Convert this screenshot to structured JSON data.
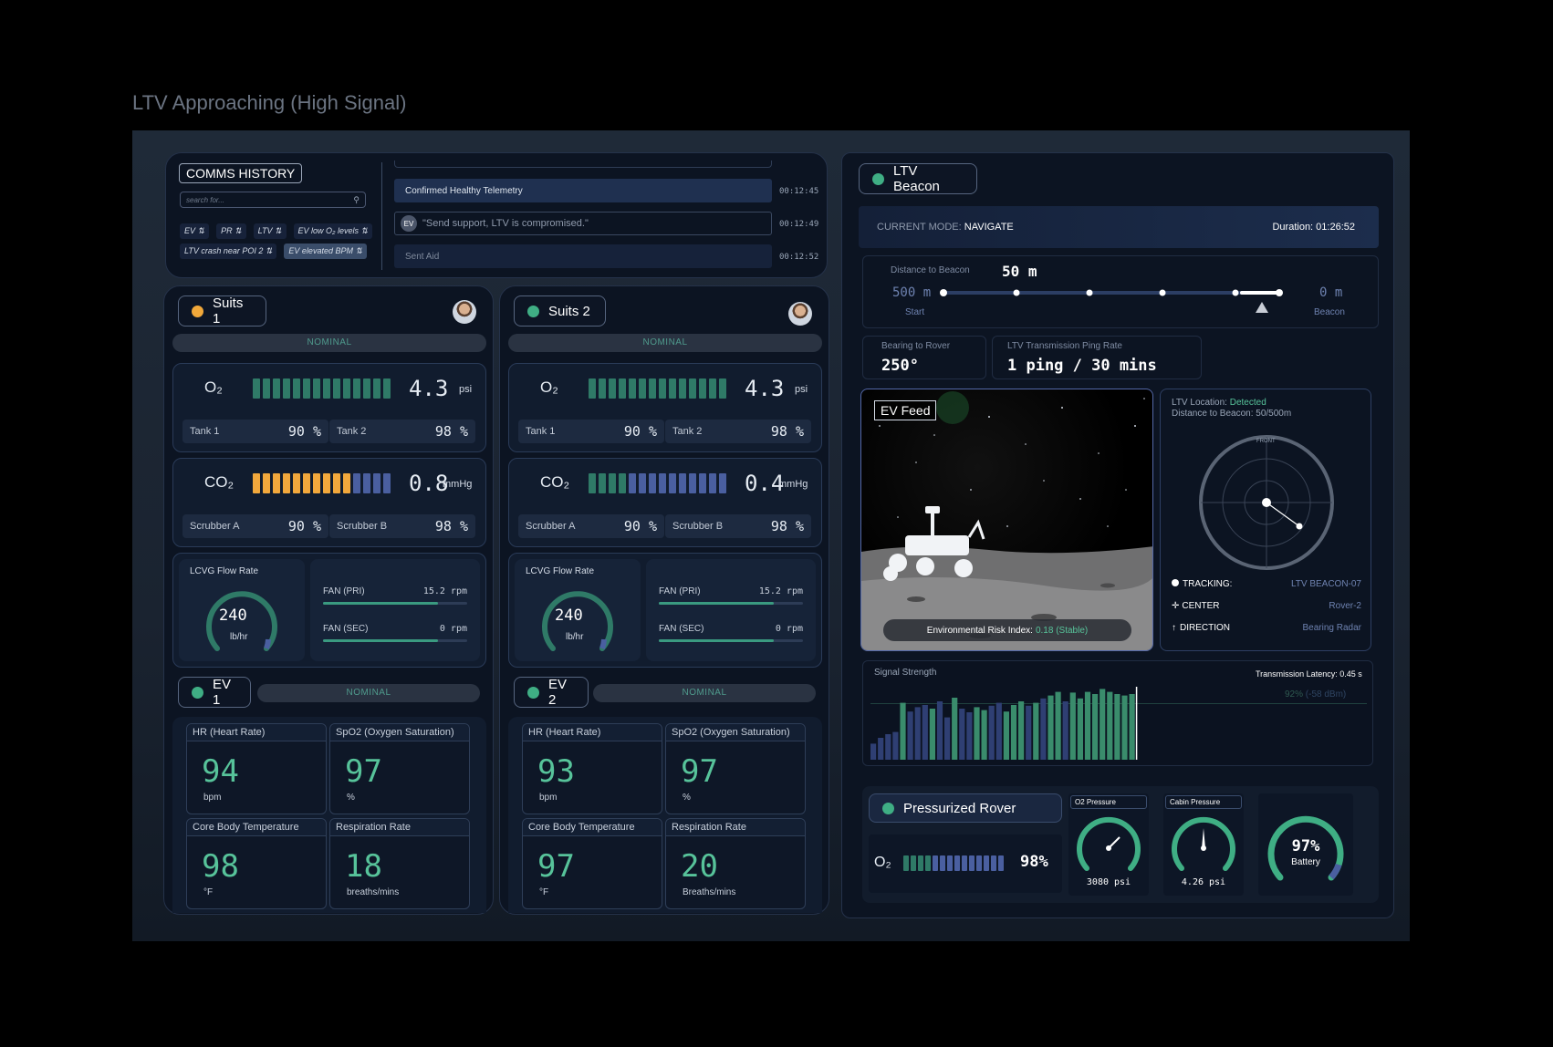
{
  "page_title": "LTV Approaching (High Signal)",
  "comms": {
    "title": "COMMS HISTORY",
    "search_placeholder": "search for...",
    "tags": [
      {
        "label": "EV"
      },
      {
        "label": "PR"
      },
      {
        "label": "LTV"
      },
      {
        "label": "EV low O₂ levels"
      },
      {
        "label": "LTV crash near POI 2"
      },
      {
        "label": "EV elevated BPM"
      }
    ],
    "messages": [
      {
        "text": "Confirmed Healthy Telemetry",
        "time": "00:12:45"
      },
      {
        "avatar": "EV",
        "text": "\"Send support, LTV is compromised.\"",
        "time": "00:12:49"
      },
      {
        "text": "Sent Aid",
        "time": "00:12:52"
      }
    ]
  },
  "suits": [
    {
      "title": "Suits 1",
      "status": "NOMINAL",
      "o2": {
        "label": "O₂",
        "value": "4.3",
        "unit": "psi",
        "tank1_label": "Tank 1",
        "tank1": "90 %",
        "tank2_label": "Tank 2",
        "tank2": "98 %"
      },
      "co2": {
        "label": "CO₂",
        "value": "0.8",
        "unit": "mmHg",
        "a_label": "Scrubber A",
        "a": "90 %",
        "b_label": "Scrubber B",
        "b": "98 %"
      },
      "lcvg": {
        "label": "LCVG Flow Rate",
        "value": "240",
        "unit": "lb/hr",
        "fan_pri_label": "FAN (PRI)",
        "fan_pri": "15.2 rpm",
        "fan_sec_label": "FAN (SEC)",
        "fan_sec": "0 rpm"
      },
      "ev": {
        "title": "EV 1",
        "status": "NOMINAL",
        "hr_label": "HR (Heart Rate)",
        "hr": "94",
        "hr_unit": "bpm",
        "spo2_label": "SpO2 (Oxygen Saturation)",
        "spo2": "97",
        "spo2_unit": "%",
        "temp_label": "Core Body Temperature",
        "temp": "98",
        "temp_unit": "°F",
        "resp_label": "Respiration Rate",
        "resp": "18",
        "resp_unit": "breaths/mins"
      }
    },
    {
      "title": "Suits 2",
      "status": "NOMINAL",
      "o2": {
        "label": "O₂",
        "value": "4.3",
        "unit": "psi",
        "tank1_label": "Tank 1",
        "tank1": "90 %",
        "tank2_label": "Tank 2",
        "tank2": "98 %"
      },
      "co2": {
        "label": "CO₂",
        "value": "0.4",
        "unit": "mmHg",
        "a_label": "Scrubber A",
        "a": "90 %",
        "b_label": "Scrubber B",
        "b": "98 %"
      },
      "lcvg": {
        "label": "LCVG Flow Rate",
        "value": "240",
        "unit": "lb/hr",
        "fan_pri_label": "FAN (PRI)",
        "fan_pri": "15.2 rpm",
        "fan_sec_label": "FAN (SEC)",
        "fan_sec": "0 rpm"
      },
      "ev": {
        "title": "EV 2",
        "status": "NOMINAL",
        "hr_label": "HR (Heart Rate)",
        "hr": "93",
        "hr_unit": "bpm",
        "spo2_label": "SpO2 (Oxygen Saturation)",
        "spo2": "97",
        "spo2_unit": "%",
        "temp_label": "Core Body Temperature",
        "temp": "97",
        "temp_unit": "°F",
        "resp_label": "Respiration Rate",
        "resp": "20",
        "resp_unit": "Breaths/mins"
      }
    }
  ],
  "beacon": {
    "title": "LTV Beacon",
    "mode_label": "CURRENT MODE:",
    "mode": "NAVIGATE",
    "duration": "Duration: 01:26:52",
    "dist_label": "Distance to Beacon",
    "dist": "50 m",
    "start_value": "500 m",
    "start_label": "Start",
    "end_value": "0 m",
    "end_label": "Beacon",
    "bearing_label": "Bearing to Rover",
    "bearing": "250°",
    "ping_label": "LTV Transmission Ping Rate",
    "ping": "1 ping / 30 mins"
  },
  "feed": {
    "title": "EV Feed",
    "risk_label": "Environmental Risk Index:",
    "risk": "0.18 (Stable)"
  },
  "radar": {
    "loc_label": "LTV Location:",
    "loc": "Detected",
    "dist_line": "Distance to Beacon: 50/500m",
    "front": "FRONT",
    "tracking_label": "TRACKING:",
    "tracking": "LTV BEACON-07",
    "center_label": "CENTER",
    "center": "Rover-2",
    "direction_label": "DIRECTION",
    "direction": "Bearing Radar"
  },
  "signal": {
    "title": "Signal Strength",
    "latency": "Transmission Latency: 0.45 s",
    "pct": "92%",
    "dbm": "(-58 dBm)",
    "bars": [
      0.22,
      0.3,
      0.35,
      0.38,
      0.78,
      0.66,
      0.72,
      0.75,
      0.7,
      0.8,
      0.58,
      0.85,
      0.7,
      0.65,
      0.72,
      0.68,
      0.74,
      0.78,
      0.66,
      0.75,
      0.8,
      0.74,
      0.78,
      0.84,
      0.88,
      0.93,
      0.8,
      0.92,
      0.84,
      0.93,
      0.9,
      0.97,
      0.93,
      0.9,
      0.88,
      0.9
    ]
  },
  "rover": {
    "title": "Pressurized Rover",
    "o2_label": "O₂",
    "o2": "98%",
    "o2p_label": "O2 Pressure",
    "o2p": "3080 psi",
    "cabin_label": "Cabin Pressure",
    "cabin": "4.26 psi",
    "battery": "97%",
    "battery_label": "Battery"
  }
}
